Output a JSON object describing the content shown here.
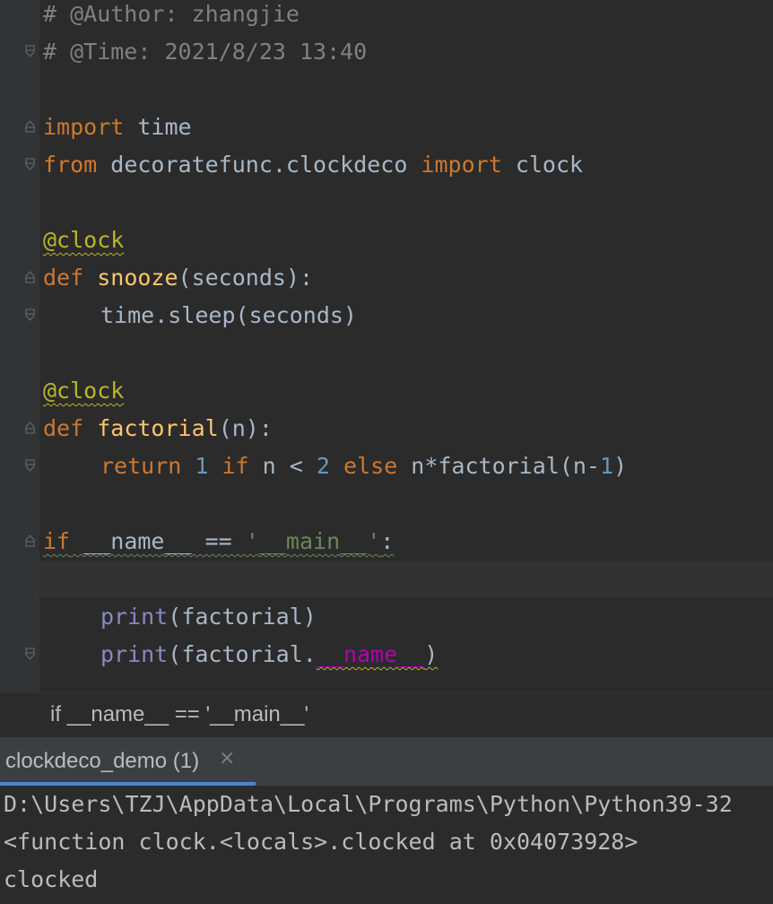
{
  "editor": {
    "lines": {
      "author_comment": "# @Author: zhangjie",
      "time_comment": "# @Time: 2021/8/23 13:40",
      "import_kw": "import",
      "import_mod": " time",
      "from_kw": "from",
      "from_mod": " decoratefunc.clockdeco ",
      "from_import_kw": "import",
      "from_name": " clock",
      "decorator1": "@clock",
      "def1_kw": "def",
      "def1_name": "snooze",
      "def1_params": "(seconds):",
      "body1": "time.sleep(seconds)",
      "decorator2": "@clock",
      "def2_kw": "def",
      "def2_name": "factorial",
      "def2_params": "(n):",
      "ret_kw": "return",
      "ret_one": "1",
      "ret_if": "if",
      "ret_cond": " n < ",
      "ret_two": "2",
      "ret_else": "else",
      "ret_expr": " n*factorial(n-",
      "ret_one2": "1",
      "ret_close": ")",
      "main_if": "if",
      "main_cond": " __name__ == ",
      "main_str": "'__main__'",
      "main_colon": ":",
      "print1_fn": "print",
      "print1_args": "(factorial)",
      "print2_fn": "print",
      "print2_open": "(factorial.",
      "print2_attr": "__name__",
      "print2_close": ")"
    }
  },
  "breadcrumb": {
    "text": "if __name__ == '__main__'"
  },
  "run_panel": {
    "tab_label": "clockdeco_demo (1)",
    "close_glyph": "×",
    "console": [
      "D:\\Users\\TZJ\\AppData\\Local\\Programs\\Python\\Python39-32",
      "<function clock.<locals>.clocked at 0x04073928>",
      "clocked"
    ]
  },
  "colors": {
    "background": "#2b2b2b",
    "keyword": "#cc7832",
    "comment": "#808080",
    "decorator": "#bbb529",
    "function": "#ffc66d",
    "number": "#6897bb",
    "string": "#6a8759",
    "builtin": "#8888c6",
    "magic": "#b200b2",
    "tab_underline": "#4a88c7"
  }
}
